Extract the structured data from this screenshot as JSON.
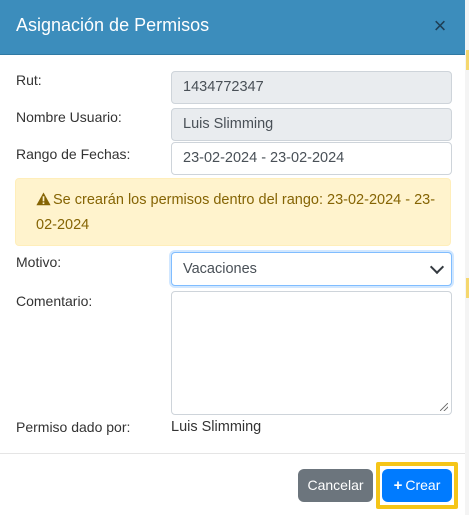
{
  "modal": {
    "title": "Asignación de Permisos",
    "close_glyph": "×"
  },
  "form": {
    "rut": {
      "label": "Rut:",
      "value": "1434772347"
    },
    "nombre": {
      "label": "Nombre Usuario:",
      "value": "Luis Slimming"
    },
    "rango": {
      "label": "Rango de Fechas:",
      "value": "23-02-2024 - 23-02-2024"
    },
    "alert": {
      "icon": "warning-icon",
      "text": "Se crearán los permisos dentro del rango: 23-02-2024 - 23-02-2024"
    },
    "motivo": {
      "label": "Motivo:",
      "selected": "Vacaciones"
    },
    "comentario": {
      "label": "Comentario:",
      "value": ""
    },
    "dado_por": {
      "label": "Permiso dado por:",
      "value": "Luis Slimming"
    }
  },
  "footer": {
    "cancel_label": "Cancelar",
    "create_icon": "+",
    "create_label": "Crear"
  },
  "colors": {
    "header": "#3c8dbc",
    "alert_bg": "#fff3cd",
    "alert_text": "#856404",
    "cancel": "#6c757d",
    "primary": "#007bff",
    "focus_highlight": "#f5c518"
  }
}
